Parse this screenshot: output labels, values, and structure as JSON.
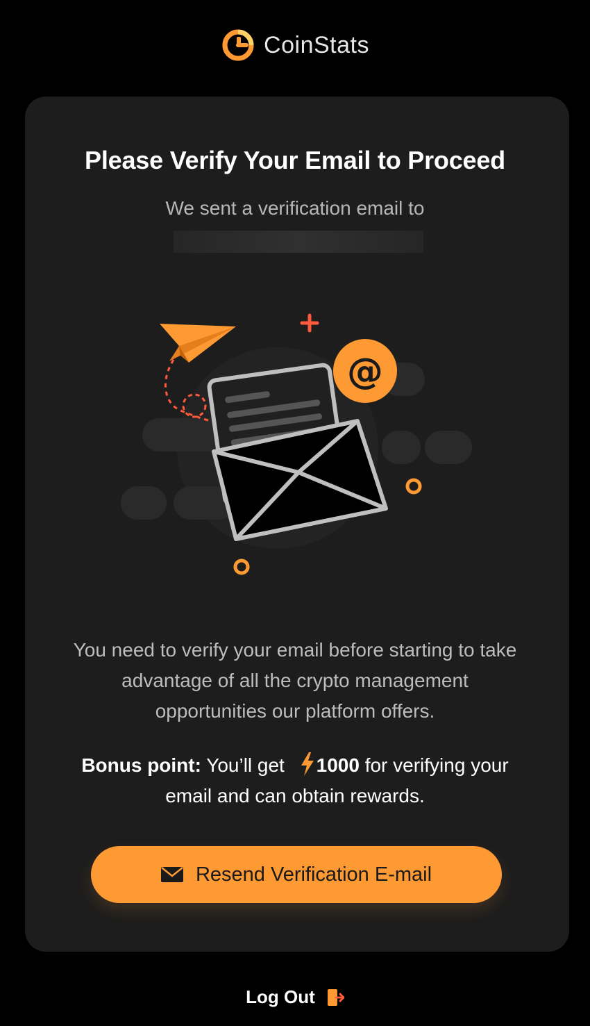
{
  "brand": {
    "name": "CoinStats",
    "accent_color": "#fe9a33",
    "logo_icon": "coinstats-logo-icon"
  },
  "verify": {
    "title": "Please Verify Your Email to Proceed",
    "subtitle": "We sent a verification email to",
    "message": "You need to verify your email before starting to take advantage of all the crypto management opportunities our platform offers.",
    "bonus_label": "Bonus point:",
    "bonus_prefix": "You’ll get",
    "bonus_amount": "1000",
    "bonus_suffix": "for verifying your email and can obtain rewards.",
    "bonus_icon": "lightning-bolt-icon",
    "illustration_icon": "open-envelope-illustration"
  },
  "actions": {
    "resend_label": "Resend Verification E-mail",
    "resend_icon": "envelope-icon",
    "logout_label": "Log Out",
    "logout_icon": "logout-icon"
  }
}
